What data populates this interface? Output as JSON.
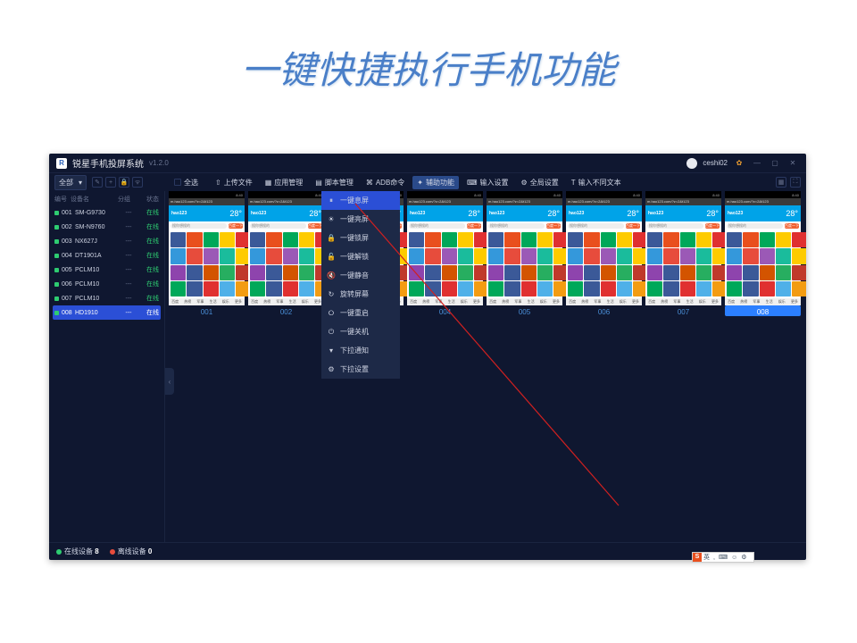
{
  "page_title": "一键快捷执行手机功能",
  "app": {
    "logo_letter": "R",
    "name": "锐星手机投屏系统",
    "version": "v1.2.0",
    "user": "ceshi02"
  },
  "filter": {
    "label": "全部"
  },
  "checkbox_label": "全选",
  "toolbar": [
    {
      "icon": "⇧",
      "label": "上传文件"
    },
    {
      "icon": "▦",
      "label": "应用管理"
    },
    {
      "icon": "▤",
      "label": "脚本管理"
    },
    {
      "icon": "⌘",
      "label": "ADB命令"
    },
    {
      "icon": "✦",
      "label": "辅助功能",
      "active": true
    },
    {
      "icon": "⌨",
      "label": "输入设置"
    },
    {
      "icon": "⚙",
      "label": "全局设置"
    },
    {
      "icon": "T",
      "label": "输入不同文本"
    }
  ],
  "sidebar": {
    "headers": [
      "编号",
      "设备名",
      "分组",
      "状态"
    ],
    "devices": [
      {
        "id": "001",
        "name": "SM-G9730",
        "group": "---",
        "status": "在线"
      },
      {
        "id": "002",
        "name": "SM-N9760",
        "group": "---",
        "status": "在线"
      },
      {
        "id": "003",
        "name": "NX627J",
        "group": "---",
        "status": "在线"
      },
      {
        "id": "004",
        "name": "DT1901A",
        "group": "---",
        "status": "在线"
      },
      {
        "id": "005",
        "name": "PCLM10",
        "group": "---",
        "status": "在线"
      },
      {
        "id": "006",
        "name": "PCLM10",
        "group": "---",
        "status": "在线"
      },
      {
        "id": "007",
        "name": "PCLM10",
        "group": "---",
        "status": "在线"
      },
      {
        "id": "008",
        "name": "HD1910",
        "group": "---",
        "status": "在线",
        "selected": true
      }
    ]
  },
  "dropdown": {
    "items": [
      {
        "icon": "⏸",
        "label": "一键息屏",
        "highlighted": true
      },
      {
        "icon": "☀",
        "label": "一键亮屏"
      },
      {
        "icon": "🔒",
        "label": "一键锁屏"
      },
      {
        "icon": "🔓",
        "label": "一键解锁"
      },
      {
        "icon": "🔇",
        "label": "一键静音"
      },
      {
        "icon": "↻",
        "label": "旋转屏幕"
      },
      {
        "icon": "⭘",
        "label": "一键重启"
      },
      {
        "icon": "⏻",
        "label": "一键关机"
      },
      {
        "icon": "▾",
        "label": "下拉通知"
      },
      {
        "icon": "⚙",
        "label": "下拉设置"
      }
    ]
  },
  "phone_screen": {
    "time": "8:40",
    "url": "m.hao123.com/?z=2&t123",
    "brand": "hao123",
    "temp": "28°",
    "search_placeholder": "搜你想搜的",
    "search_btn": "百度一下",
    "footer": [
      "百度",
      "热榜",
      "军事",
      "生活",
      "娱乐",
      "更多"
    ],
    "icon_colors": [
      "#3b5998",
      "#e94f1d",
      "#00a859",
      "#fecb00",
      "#e03030",
      "#7b68ee",
      "#4fb0e8",
      "#f39c12",
      "#2ecc71",
      "#3498db",
      "#e74c3c",
      "#9b59b6",
      "#1abc9c",
      "#fecb00",
      "#e94f1d",
      "#34495e",
      "#16a085",
      "#e67e22",
      "#8e44ad",
      "#3b5998",
      "#d35400",
      "#27ae60",
      "#c0392b",
      "#2980b9",
      "#f1c40f",
      "#7f8c8d",
      "#e94f1d",
      "#00a859",
      "#3b5998",
      "#e03030",
      "#4fb0e8",
      "#f39c12",
      "#9b59b6",
      "#2ecc71",
      "#e74c3c",
      "#fecb00"
    ]
  },
  "labels": [
    "001",
    "002",
    "003",
    "004",
    "005",
    "006",
    "007",
    "008"
  ],
  "selected_label_index": 7,
  "status": {
    "online_label": "在线设备",
    "online_count": "8",
    "offline_label": "离线设备",
    "offline_count": "0"
  },
  "ime": {
    "logo": "S",
    "chars": [
      "英",
      ",",
      "⌨",
      "☺",
      "⚙"
    ]
  }
}
